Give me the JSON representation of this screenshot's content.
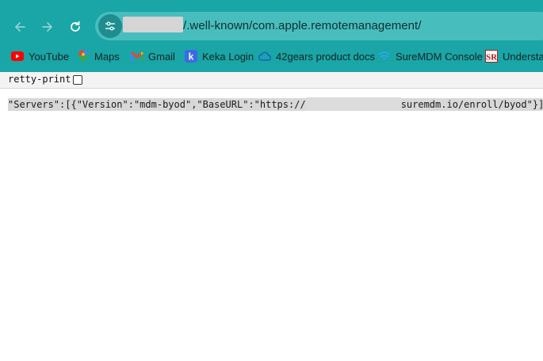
{
  "browser": {
    "url_visible": "/.well-known/com.apple.remotemanagement/",
    "nav": {
      "back_icon": "arrow-left-icon",
      "forward_icon": "arrow-right-icon",
      "reload_icon": "reload-icon",
      "site_info_icon": "tune-icon"
    },
    "bookmarks": [
      {
        "label": "YouTube",
        "icon": "youtube-icon"
      },
      {
        "label": "Maps",
        "icon": "maps-icon"
      },
      {
        "label": "Gmail",
        "icon": "gmail-icon"
      },
      {
        "label": "Keka Login",
        "icon": "keka-icon"
      },
      {
        "label": "42gears product docs",
        "icon": "cloud-icon"
      },
      {
        "label": "SureMDM Console",
        "icon": "wifi-icon"
      },
      {
        "label": "Understan",
        "icon": "sr-icon"
      }
    ],
    "colors": {
      "toolbar": "#1aa5a6",
      "omnibox": "#48bdbd"
    }
  },
  "page": {
    "pretty_print_label": "retty-print",
    "pretty_print_checked": false,
    "json_prefix": "\"Servers\":[{\"Version\":\"mdm-byod\",\"BaseURL\":\"https://",
    "json_suffix": "suremdm.io/enroll/byod\"}]}"
  }
}
